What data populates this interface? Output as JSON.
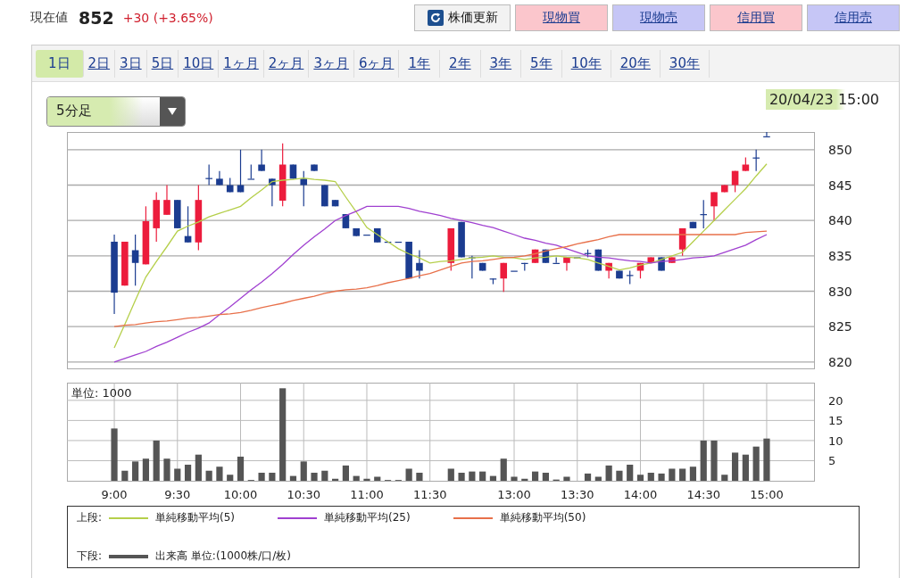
{
  "quote": {
    "label": "現在値",
    "price": "852",
    "change": "+30 (+3.65%)"
  },
  "actions": [
    {
      "kind": "refresh",
      "label": "株価更新"
    },
    {
      "kind": "buy",
      "label": "現物買"
    },
    {
      "kind": "sell",
      "label": "現物売"
    },
    {
      "kind": "buy",
      "label": "信用買"
    },
    {
      "kind": "sell",
      "label": "信用売"
    }
  ],
  "tabs": [
    {
      "label": "1日",
      "selected": true
    },
    {
      "label": "2日",
      "selected": false
    },
    {
      "label": "3日",
      "selected": false
    },
    {
      "label": "5日",
      "selected": false
    },
    {
      "label": "10日",
      "selected": false
    },
    {
      "label": "1ヶ月",
      "selected": false
    },
    {
      "label": "2ヶ月",
      "selected": false
    },
    {
      "label": "3ヶ月",
      "selected": false
    },
    {
      "label": "6ヶ月",
      "selected": false
    },
    {
      "label": "1年",
      "selected": false
    },
    {
      "label": "2年",
      "selected": false
    },
    {
      "label": "3年",
      "selected": false
    },
    {
      "label": "5年",
      "selected": false
    },
    {
      "label": "10年",
      "selected": false
    },
    {
      "label": "20年",
      "selected": false
    },
    {
      "label": "30年",
      "selected": false
    }
  ],
  "interval_select": {
    "value": "5分足"
  },
  "timestamp": "20/04/23 15:00",
  "price_chart": {
    "chart_data": {
      "type": "candlestick",
      "grid": true,
      "ylim": [
        819.1,
        852.5
      ],
      "yticks": [
        820,
        825,
        830,
        835,
        840,
        845,
        850
      ],
      "categories": [
        null,
        null,
        null,
        null,
        null,
        null,
        null,
        null,
        null,
        null,
        null,
        null,
        null,
        null,
        null,
        null,
        null,
        null,
        null,
        null,
        null,
        null,
        null,
        null,
        null,
        null,
        null,
        null,
        null,
        null,
        null,
        null,
        null,
        null,
        null,
        null,
        null,
        null,
        null,
        null,
        null,
        null,
        null,
        null,
        null,
        null,
        null,
        null,
        null,
        null,
        null,
        null,
        null,
        null,
        null,
        null,
        null,
        null,
        null,
        null,
        null,
        null,
        null,
        null,
        null,
        null,
        null,
        null,
        null,
        null,
        null
      ],
      "ohlc": [
        null,
        null,
        null,
        null,
        [
          837,
          838,
          826.8,
          829.8
        ],
        [
          830.8,
          837,
          830.8,
          837
        ],
        [
          835.8,
          838,
          830.8,
          834
        ],
        [
          833.8,
          842,
          833.8,
          839.9
        ],
        [
          838.9,
          844,
          837,
          842.9
        ],
        [
          840.8,
          845,
          840.8,
          842.9
        ],
        [
          842.9,
          842.9,
          838.9,
          838.9
        ],
        [
          837.8,
          842,
          836.9,
          836.9
        ],
        [
          836.9,
          845,
          835.8,
          842.9
        ],
        [
          846,
          847.9,
          845,
          846
        ],
        [
          845.9,
          847,
          845,
          845
        ],
        [
          845,
          846,
          844,
          844
        ],
        [
          845,
          850,
          844,
          844
        ],
        [
          845.9,
          847.9,
          845.9,
          845.9
        ],
        [
          847.9,
          850,
          847,
          847
        ],
        [
          845.9,
          845.9,
          842,
          845
        ],
        [
          842.8,
          850.9,
          842,
          847.9
        ],
        [
          847.9,
          847.9,
          845.9,
          845.9
        ],
        [
          845.9,
          847,
          842,
          845
        ],
        [
          847.9,
          847.9,
          847,
          847
        ],
        [
          845,
          845,
          842,
          842
        ],
        [
          842.9,
          842.9,
          842,
          842
        ],
        [
          840.9,
          840.9,
          838.9,
          838.9
        ],
        [
          838.9,
          838.9,
          837.8,
          837.8
        ],
        [
          838,
          838,
          838,
          838
        ],
        [
          838.9,
          838.9,
          836.9,
          836.9
        ],
        [
          837,
          837,
          837,
          837
        ],
        [
          837,
          837,
          837,
          837
        ],
        [
          837,
          837,
          831.8,
          831.8
        ],
        [
          834,
          835.8,
          831.8,
          832.9
        ],
        null,
        null,
        [
          834,
          838.9,
          832.9,
          838.9
        ],
        [
          839.8,
          839.8,
          834.8,
          834.8
        ],
        [
          834.8,
          835,
          831.8,
          834.8
        ],
        [
          834,
          834,
          832.9,
          832.9
        ],
        [
          831.8,
          831.8,
          831,
          831.8
        ],
        [
          831.8,
          834,
          829.9,
          834
        ],
        [
          832.9,
          832.9,
          832.9,
          832.9
        ],
        [
          834,
          834,
          832.9,
          834
        ],
        [
          834,
          835.9,
          834,
          835.9
        ],
        [
          835.9,
          835.9,
          834,
          834
        ],
        [
          834,
          834.8,
          834,
          834
        ],
        [
          834,
          834.8,
          832.9,
          834.8
        ],
        [
          834.8,
          834.8,
          834.8,
          834.8
        ],
        [
          835.4,
          835.9,
          834.8,
          835.4
        ],
        [
          835.9,
          835.9,
          832.9,
          832.9
        ],
        [
          832.9,
          834,
          831.8,
          834
        ],
        [
          832.9,
          832.9,
          831.8,
          831.8
        ],
        [
          832.3,
          832.9,
          831,
          832.3
        ],
        [
          832.9,
          834,
          831.8,
          834
        ],
        [
          834,
          834.8,
          834,
          834.8
        ],
        [
          834.8,
          834.8,
          832.9,
          832.9
        ],
        [
          834,
          834.8,
          834,
          834.8
        ],
        [
          835.9,
          838.9,
          835,
          838.9
        ],
        [
          839.8,
          839.8,
          838.9,
          838.9
        ],
        [
          840.9,
          842.9,
          838.9,
          840.9
        ],
        [
          842,
          844,
          839.9,
          844
        ],
        [
          844,
          845,
          844,
          845
        ],
        [
          845,
          847,
          844,
          847
        ],
        [
          847,
          848.9,
          847,
          847.9
        ],
        [
          848.9,
          850,
          847,
          848.9
        ],
        [
          851.9,
          852.7,
          851.9,
          851.9
        ],
        null,
        null,
        null,
        null
      ],
      "series": [
        {
          "name": "単純移動平均(5)",
          "type": "line",
          "color": "#b5cf4a",
          "values": [
            null,
            null,
            null,
            null,
            822,
            825.3,
            828.7,
            832,
            834.2,
            836.3,
            838.5,
            839.2,
            839.8,
            840.5,
            841,
            841.5,
            842,
            843.2,
            844.3,
            845.5,
            845.7,
            845.8,
            846,
            845.8,
            845.7,
            845.5,
            843.3,
            841.2,
            839,
            838,
            837,
            836,
            835.3,
            834.7,
            834,
            834.2,
            834.3,
            834.5,
            834.7,
            834.8,
            835,
            834.8,
            834.7,
            834.5,
            834.7,
            834.8,
            835,
            834.8,
            834.7,
            834.5,
            834,
            833.5,
            833,
            833.3,
            833.7,
            834,
            834.5,
            835,
            835.5,
            837,
            838.5,
            840,
            841.5,
            843,
            844.5,
            846.3,
            848,
            null,
            null,
            null,
            null
          ]
        },
        {
          "name": "単純移動平均(25)",
          "type": "line",
          "color": "#a040d0",
          "values": [
            null,
            null,
            null,
            null,
            820,
            820.5,
            821,
            821.5,
            822.2,
            822.8,
            823.5,
            824.2,
            824.8,
            825.5,
            826.7,
            827.8,
            829,
            830.2,
            831.3,
            832.5,
            833.8,
            835.2,
            836.5,
            837.7,
            838.8,
            840,
            840.7,
            841.3,
            842,
            842,
            842,
            842,
            841.7,
            841.3,
            841,
            840.7,
            840.3,
            840,
            839.7,
            839.3,
            839,
            838.5,
            838,
            837.5,
            837.2,
            836.8,
            836.5,
            836,
            835.5,
            835,
            834.8,
            834.7,
            834.5,
            834.3,
            834.2,
            834,
            834.2,
            834.3,
            834.5,
            834.7,
            834.8,
            835,
            835.5,
            836,
            836.5,
            837.3,
            838,
            null,
            null,
            null,
            null
          ]
        },
        {
          "name": "単純移動平均(50)",
          "type": "line",
          "color": "#e8704a",
          "values": [
            null,
            null,
            null,
            null,
            825,
            825.2,
            825.3,
            825.5,
            825.7,
            825.8,
            826,
            826.2,
            826.3,
            826.5,
            826.7,
            826.8,
            827,
            827.3,
            827.7,
            828,
            828.3,
            828.7,
            829,
            829.3,
            829.7,
            830,
            830.2,
            830.3,
            830.5,
            830.8,
            831.2,
            831.5,
            831.8,
            832.2,
            832.5,
            833,
            833.5,
            834,
            834.2,
            834.3,
            834.5,
            834.7,
            834.8,
            835,
            835.3,
            835.7,
            836,
            836.3,
            836.7,
            837,
            837.3,
            837.7,
            838,
            838,
            838,
            838,
            838,
            838,
            838,
            838,
            838,
            838,
            838,
            838,
            838.3,
            838.4,
            838.5,
            null,
            null,
            null,
            null
          ]
        }
      ]
    }
  },
  "volume_chart": {
    "unit_label": "単位: 1000",
    "chart_data": {
      "type": "bar",
      "grid": true,
      "ylim": [
        0,
        24.4
      ],
      "yticks": [
        5,
        10,
        15,
        20
      ],
      "categories": [
        null,
        null,
        null,
        null,
        "9:00",
        null,
        null,
        null,
        null,
        null,
        "9:30",
        null,
        null,
        null,
        null,
        null,
        "10:00",
        null,
        null,
        null,
        null,
        null,
        "10:30",
        null,
        null,
        null,
        null,
        null,
        "11:00",
        null,
        null,
        null,
        null,
        null,
        "11:30",
        null,
        null,
        null,
        null,
        null,
        null,
        null,
        "13:00",
        null,
        null,
        null,
        null,
        null,
        "13:30",
        null,
        null,
        null,
        null,
        null,
        "14:00",
        null,
        null,
        null,
        null,
        null,
        "14:30",
        null,
        null,
        null,
        null,
        null,
        "15:00",
        null,
        null,
        null,
        null
      ],
      "series": [
        {
          "name": "出来高 単位:(1000株/口/枚)",
          "color": "#555555",
          "values": [
            null,
            null,
            null,
            null,
            13,
            2.5,
            4.8,
            5.5,
            10,
            5.5,
            3,
            4,
            6.5,
            2.5,
            3.5,
            1.5,
            6,
            0.2,
            2,
            2,
            23,
            1.2,
            4.8,
            2,
            2.5,
            0.5,
            3.8,
            1.2,
            0.5,
            1,
            0.2,
            0.2,
            3,
            2,
            0,
            0,
            3,
            2,
            2.3,
            2.3,
            1.2,
            5.5,
            1,
            0.5,
            2.3,
            2,
            0.3,
            1,
            0,
            1.8,
            1,
            3.8,
            2.5,
            4,
            1.5,
            2,
            1.8,
            3,
            3,
            3.5,
            10,
            10,
            1.5,
            7,
            6.5,
            8.5,
            10.5,
            null,
            null,
            null,
            null
          ]
        }
      ]
    }
  },
  "legend": {
    "upper_label": "上段:",
    "lower_label": "下段:"
  }
}
